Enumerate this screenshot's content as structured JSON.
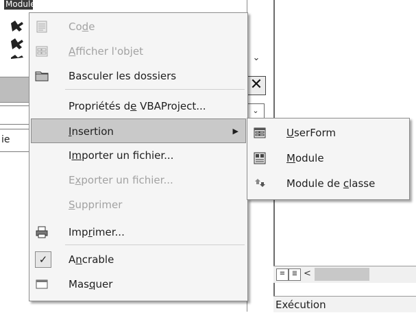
{
  "background": {
    "modules_tab": "Modules",
    "tab_stub": "ie",
    "execution_label": "Exécution",
    "scroll_left_glyph": "<"
  },
  "menu": {
    "items": [
      {
        "pre": "Co",
        "u": "d",
        "post": "e",
        "icon": "code-icon",
        "disabled": true
      },
      {
        "pre": "",
        "u": "A",
        "post": "fficher l'objet",
        "icon": "form-icon",
        "disabled": true
      },
      {
        "pre": "Basculer les dossiers",
        "u": "",
        "post": "",
        "icon": "folder-icon",
        "disabled": false
      },
      {
        "pre": "Propriétés d",
        "u": "e",
        "post": " VBAProject...",
        "icon": "",
        "disabled": false
      },
      {
        "pre": "",
        "u": "I",
        "post": "nsertion",
        "icon": "",
        "disabled": false,
        "submenu": true
      },
      {
        "pre": "I",
        "u": "m",
        "post": "porter un fichier...",
        "icon": "",
        "disabled": false
      },
      {
        "pre": "E",
        "u": "x",
        "post": "porter un fichier...",
        "icon": "",
        "disabled": true
      },
      {
        "pre": "",
        "u": "S",
        "post": "upprimer",
        "icon": "",
        "disabled": true
      },
      {
        "pre": "Imp",
        "u": "r",
        "post": "imer...",
        "icon": "printer-icon",
        "disabled": false
      },
      {
        "pre": "A",
        "u": "n",
        "post": "crable",
        "icon": "checkmark-icon",
        "disabled": false,
        "checked": true
      },
      {
        "pre": "Mas",
        "u": "q",
        "post": "uer",
        "icon": "window-icon",
        "disabled": false
      }
    ],
    "submenu_arrow": "▶"
  },
  "submenu": {
    "items": [
      {
        "pre": "",
        "u": "U",
        "post": "serForm",
        "icon": "userform-icon"
      },
      {
        "pre": "",
        "u": "M",
        "post": "odule",
        "icon": "module-icon"
      },
      {
        "pre": "Module de ",
        "u": "c",
        "post": "lasse",
        "icon": "class-module-icon"
      }
    ]
  }
}
